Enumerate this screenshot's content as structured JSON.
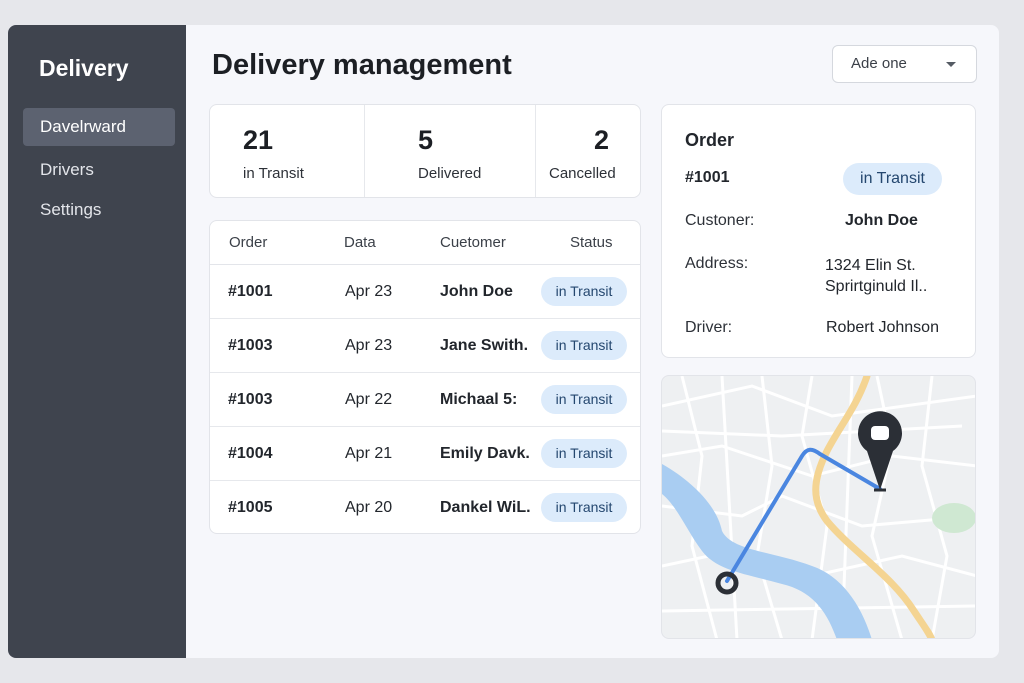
{
  "sidebar": {
    "brand": "Delivery",
    "items": [
      {
        "label": "Davelrward",
        "active": true
      },
      {
        "label": "Drivers",
        "active": false
      },
      {
        "label": "Settings",
        "active": false
      }
    ]
  },
  "header": {
    "title": "Delivery management",
    "select_value": "Ade one"
  },
  "stats": [
    {
      "value": "21",
      "label": "in Transit"
    },
    {
      "value": "5",
      "label": "Delivered"
    },
    {
      "value": "2",
      "label": "Cancelled"
    }
  ],
  "orders": {
    "columns": [
      "Order",
      "Data",
      "Cuetomer",
      "Status"
    ],
    "rows": [
      {
        "order": "#1001",
        "date": "Apr 23",
        "customer": "John Doe",
        "status": "in Transit"
      },
      {
        "order": "#1003",
        "date": "Apr 23",
        "customer": "Jane Swith.",
        "status": "in Transit"
      },
      {
        "order": "#1003",
        "date": "Apr 22",
        "customer": "Michaal 5:",
        "status": "in Transit"
      },
      {
        "order": "#1004",
        "date": "Apr 21",
        "customer": "Emily Davk.",
        "status": "in Transit"
      },
      {
        "order": "#1005",
        "date": "Apr 20",
        "customer": "Dankel WiL.",
        "status": "in Transit"
      }
    ]
  },
  "detail": {
    "heading": "Order",
    "order_id": "#1001",
    "status": "in Transit",
    "customer_label": "Custoner:",
    "customer_value": "John Doe",
    "address_label": "Address:",
    "address_line1": "1324 Elin St.",
    "address_line2": "Sprirtginuld Il..",
    "driver_label": "Driver:",
    "driver_value": "Robert Johnson"
  },
  "map": {
    "route_color": "#4a86e0",
    "river_color": "#a9cdf2",
    "highway_color": "#f4d492",
    "pin_color": "#2b2f36",
    "park_color": "#cfe8d2",
    "destination_icon": "map-pin-icon",
    "origin_icon": "origin-marker-icon"
  },
  "colors": {
    "sidebar_bg": "#3f444e",
    "active_item_bg": "#5c6270",
    "badge_bg": "#dcebfb",
    "badge_text": "#24476f"
  }
}
